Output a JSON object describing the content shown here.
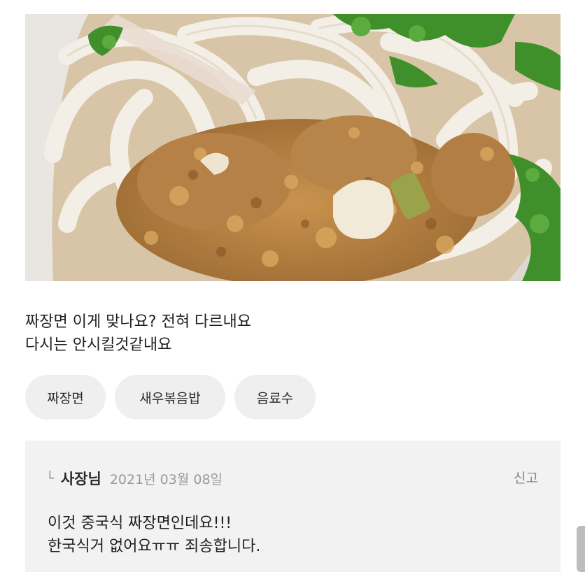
{
  "review": {
    "text_line1": "짜장면 이게 맞나요? 전혀 다르내요",
    "text_line2": "다시는 안시킬것같내요",
    "photo_description": "noodle-dish-photo"
  },
  "menu_chips": [
    {
      "label": "짜장면"
    },
    {
      "label": "새우볶음밥"
    },
    {
      "label": "음료수"
    }
  ],
  "owner_reply": {
    "arrow_icon": "reply-arrow-icon",
    "author": "사장님",
    "date": "2021년 03월 08일",
    "report_label": "신고",
    "text_line1": "이것 중국식 짜장면인데요!!!",
    "text_line2": "한국식거 없어요ㅠㅠ 죄송합니다."
  },
  "colors": {
    "chip_background": "#efefef",
    "reply_background": "#f2f2f2",
    "date_gray": "#9a9a9a"
  }
}
